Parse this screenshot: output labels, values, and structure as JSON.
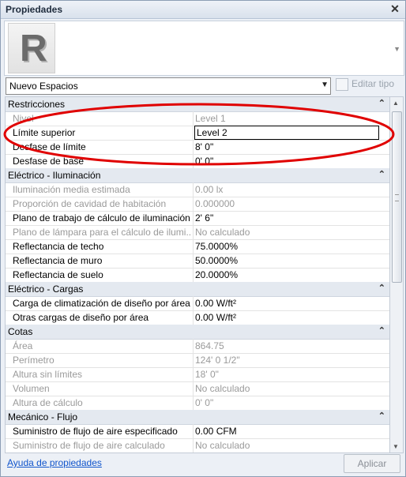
{
  "window": {
    "title": "Propiedades",
    "close_glyph": "✕"
  },
  "type_selector": {
    "logo_letter": "R",
    "value": "Nuevo Espacios",
    "edit_type_label": "Editar tipo"
  },
  "categories": [
    {
      "label": "Restricciones",
      "rows": [
        {
          "name": "Nivel",
          "value": "Level 1",
          "disabled": true
        },
        {
          "name": "Límite superior",
          "value": "Level 2",
          "disabled": false,
          "editing": true
        },
        {
          "name": "Desfase de límite",
          "value": "8'  0\"",
          "disabled": false
        },
        {
          "name": "Desfase de base",
          "value": "0'  0\"",
          "disabled": false
        }
      ]
    },
    {
      "label": "Eléctrico - Iluminación",
      "rows": [
        {
          "name": "Iluminación media estimada",
          "value": "0.00 lx",
          "disabled": true
        },
        {
          "name": "Proporción de cavidad de habitación",
          "value": "0.000000",
          "disabled": true
        },
        {
          "name": "Plano de trabajo de cálculo de iluminación",
          "value": "2'  6\"",
          "disabled": false
        },
        {
          "name": "Plano de lámpara para el cálculo de ilumi...",
          "value": "No calculado",
          "disabled": true
        },
        {
          "name": "Reflectancia de techo",
          "value": "75.0000%",
          "disabled": false
        },
        {
          "name": "Reflectancia de muro",
          "value": "50.0000%",
          "disabled": false
        },
        {
          "name": "Reflectancia de suelo",
          "value": "20.0000%",
          "disabled": false
        }
      ]
    },
    {
      "label": "Eléctrico - Cargas",
      "rows": [
        {
          "name": "Carga de climatización de diseño por área",
          "value": "0.00 W/ft²",
          "disabled": false
        },
        {
          "name": "Otras cargas de diseño por área",
          "value": "0.00 W/ft²",
          "disabled": false
        }
      ]
    },
    {
      "label": "Cotas",
      "rows": [
        {
          "name": "Área",
          "value": "864.75",
          "disabled": true
        },
        {
          "name": "Perímetro",
          "value": "124'  0 1/2\"",
          "disabled": true
        },
        {
          "name": "Altura sin límites",
          "value": "18'  0\"",
          "disabled": true
        },
        {
          "name": "Volumen",
          "value": "No calculado",
          "disabled": true
        },
        {
          "name": "Altura de cálculo",
          "value": "0'  0\"",
          "disabled": true
        }
      ]
    },
    {
      "label": "Mecánico - Flujo",
      "rows": [
        {
          "name": "Suministro de flujo de aire especificado",
          "value": "0.00 CFM",
          "disabled": false
        },
        {
          "name": "Suministro de flujo de aire calculado",
          "value": "No calculado",
          "disabled": true
        }
      ]
    }
  ],
  "footer": {
    "help_link": "Ayuda de propiedades",
    "apply_label": "Aplicar"
  },
  "colors": {
    "annotation_ellipse": "#e00000",
    "category_bg": "#e4e9f0",
    "link": "#1155cc"
  }
}
